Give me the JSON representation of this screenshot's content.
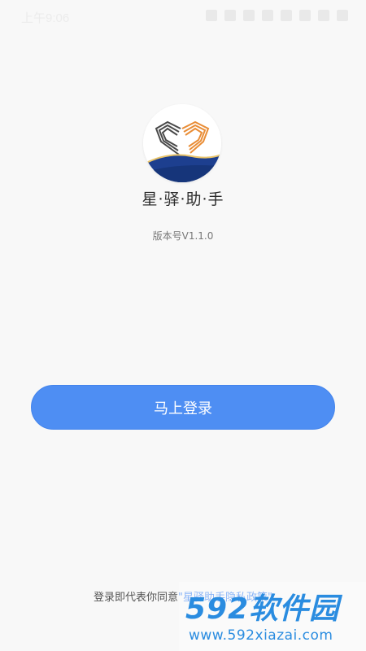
{
  "status_bar": {
    "time": "上午9:06",
    "icons": [
      "signal-icon",
      "alarm-icon",
      "vibrate-icon",
      "sim-icon",
      "battery-saver-icon",
      "wifi-icon",
      "mobile-signal-icon",
      "battery-icon"
    ]
  },
  "app": {
    "name": "星·驿·助·手",
    "version": "版本号V1.1.0"
  },
  "login": {
    "button_label": "马上登录"
  },
  "agreement": {
    "prefix": "登录即代表你同意",
    "policy_link": "\"星驿助手隐私政策\""
  },
  "watermark": {
    "brand": "592软件园",
    "url": "www.592xiazai.com"
  },
  "colors": {
    "accent": "#4e8ef3",
    "logo_orange": "#e98d36",
    "logo_navy": "#1d3f8f"
  }
}
